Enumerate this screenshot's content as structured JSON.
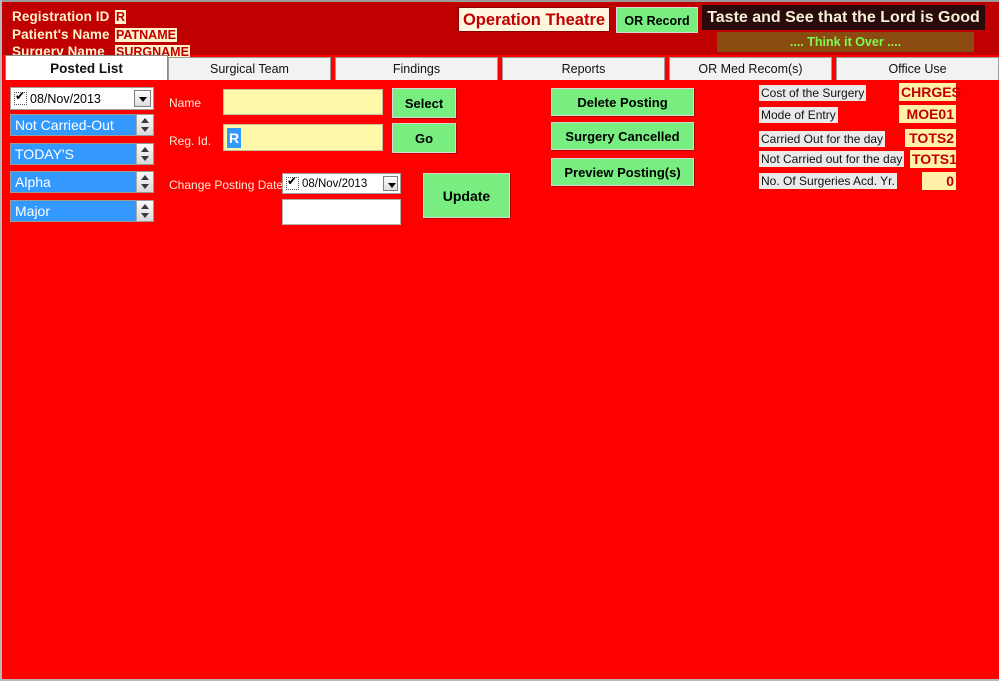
{
  "window": {
    "background_color": "#FF0000",
    "header_color": "#C00000"
  },
  "header": {
    "fields": [
      {
        "label": "Registration ID",
        "value": "R"
      },
      {
        "label": "Patient's Name",
        "value": "PATNAME"
      },
      {
        "label": "Surgery Name",
        "value": "SURGNAME"
      }
    ],
    "app_title": "Operation Theatre",
    "or_record_button": "OR Record",
    "scripture_line": "Taste and See that the Lord is Good",
    "think_it_over_line": ".... Think it Over ...."
  },
  "tabs": {
    "active_index": 0,
    "items": [
      {
        "label": "Posted List"
      },
      {
        "label": "Surgical Team"
      },
      {
        "label": "Findings"
      },
      {
        "label": "Reports"
      },
      {
        "label": "OR Med Recom(s)"
      },
      {
        "label": "Office Use"
      }
    ]
  },
  "sidebar": {
    "date_filter": {
      "value": "08/Nov/2013",
      "checked": true
    },
    "selectors": [
      {
        "value": "Not Carried-Out"
      },
      {
        "value": "TODAY'S"
      },
      {
        "value": "Alpha"
      },
      {
        "value": "Major"
      }
    ]
  },
  "form": {
    "name_label": "Name",
    "name_value": "",
    "name_placeholder": "",
    "regid_label": "Reg. Id.",
    "regid_value": "R",
    "regid_placeholder": "",
    "select_button": "Select",
    "go_button": "Go",
    "change_posting_date_label": "Change Posting Date",
    "change_posting_date_value": "08/Nov/2013",
    "change_posting_date_checked": true,
    "posting_note_value": "",
    "posting_note_placeholder": "",
    "update_button": "Update"
  },
  "actions": {
    "buttons": [
      {
        "label": "Delete Posting"
      },
      {
        "label": "Surgery Cancelled"
      },
      {
        "label": "Preview Posting(s)"
      }
    ]
  },
  "info_panel": {
    "rows": [
      {
        "label": "Cost of the Surgery",
        "value": "CHRGES"
      },
      {
        "label": "Mode of Entry",
        "value": "MOE01"
      },
      {
        "label": "Carried Out for the day",
        "value": "TOTS2"
      },
      {
        "label": "Not Carried out for the day",
        "value": "TOTS1"
      },
      {
        "label": "No. Of Surgeries Acd. Yr.",
        "value": "0"
      }
    ]
  }
}
